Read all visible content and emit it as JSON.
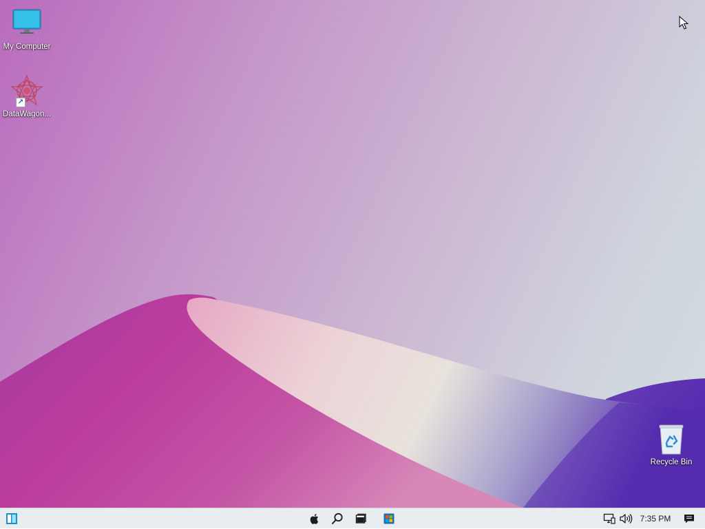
{
  "desktop": {
    "icons": [
      {
        "label": "My Computer",
        "icon": "monitor-icon"
      },
      {
        "label": "DataWagon...",
        "icon": "datawagon-star-icon"
      },
      {
        "label": "Recycle Bin",
        "icon": "recycle-bin-icon"
      }
    ],
    "colors": {
      "dune_magenta": "#b23aa0",
      "dune_light": "#e8ddd6",
      "dune_violet": "#5a2fb0"
    }
  },
  "taskbar": {
    "start_icon": "start-menu-icon",
    "center_icons": [
      "apple-icon",
      "search-icon",
      "file-manager-icon",
      "store-icon"
    ],
    "tray_icons": [
      "network-icon",
      "volume-icon",
      "notification-icon"
    ],
    "clock": "7:35 PM"
  }
}
